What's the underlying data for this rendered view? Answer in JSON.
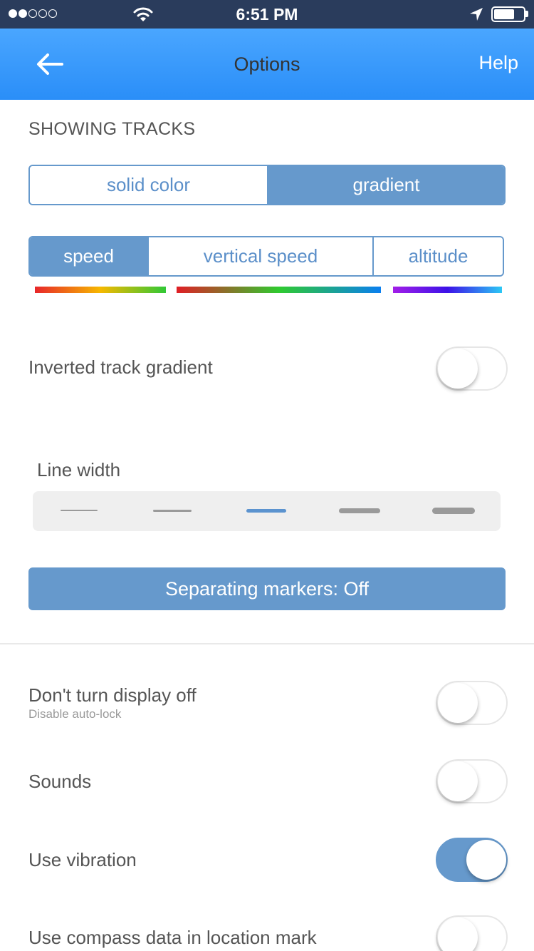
{
  "status_bar": {
    "time": "6:51 PM",
    "signal_dots_filled": 2,
    "signal_dots_total": 5,
    "battery_level": 0.7,
    "icons": [
      "signal-dots-icon",
      "wifi-icon",
      "location-arrow-icon",
      "battery-icon"
    ]
  },
  "header": {
    "title": "Options",
    "help_label": "Help",
    "back_icon": "back-arrow-icon",
    "background": "#2a8ef8"
  },
  "tracks": {
    "section_title": "SHOWING TRACKS",
    "mode_options": [
      "solid color",
      "gradient"
    ],
    "mode_selected": "gradient",
    "metric_options": [
      "speed",
      "vertical speed",
      "altitude"
    ],
    "metric_selected": "speed",
    "gradients": {
      "speed": [
        "#e8262a",
        "#f6b800",
        "#30c836"
      ],
      "vertical_speed": [
        "#e01e25",
        "#2fca2f",
        "#0a7ff0"
      ],
      "altitude": [
        "#a21ee8",
        "#3c12e8",
        "#2cc8f5"
      ]
    },
    "inverted_label": "Inverted track gradient",
    "inverted_on": false,
    "line_width_label": "Line width",
    "line_width_options": 5,
    "line_width_selected": 3,
    "markers_button_label": "Separating markers: Off"
  },
  "settings": {
    "display_label": "Don't turn display off",
    "display_sublabel": "Disable auto-lock",
    "display_on": false,
    "sounds_label": "Sounds",
    "sounds_on": false,
    "vibration_label": "Use vibration",
    "vibration_on": true,
    "compass_label": "Use compass data in location mark",
    "compass_on": false
  },
  "colors": {
    "accent": "#6699cc",
    "status_bar": "#2a3c5c",
    "header_gradient_top": "#4aa6ff",
    "header_gradient_bottom": "#2a8ef8"
  }
}
